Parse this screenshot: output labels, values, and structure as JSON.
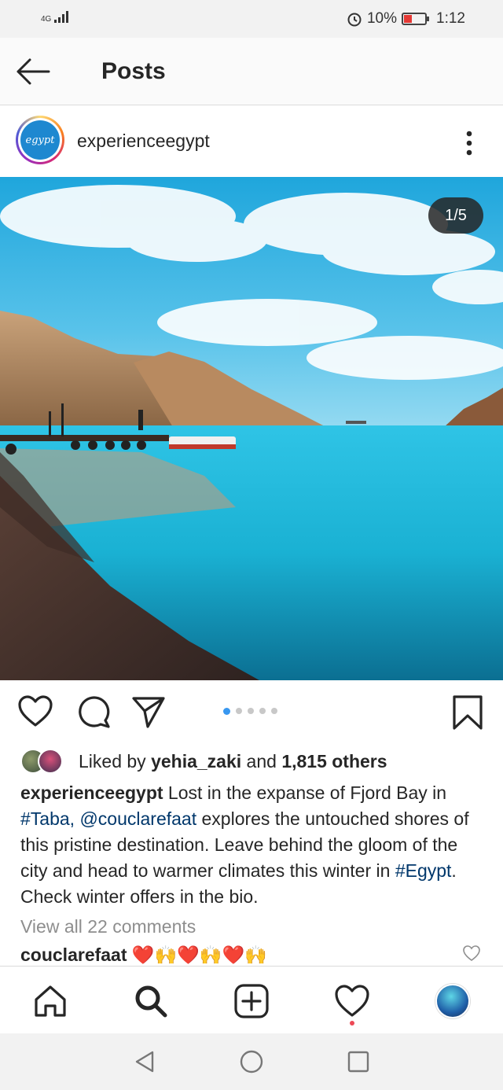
{
  "status_bar": {
    "network": "4G",
    "battery": "10%",
    "time": "1:12"
  },
  "header": {
    "title": "Posts"
  },
  "post": {
    "username": "experienceegypt",
    "avatar_text": "egypt",
    "page_counter": "1/5",
    "carousel": {
      "total": 5,
      "active": 1
    },
    "likes": {
      "prefix": "Liked by ",
      "user": "yehia_zaki",
      "middle": " and ",
      "count": "1,815 others"
    },
    "caption": {
      "username": "experienceegypt",
      "part1": " Lost in the expanse of Fjord Bay in ",
      "tag1": "#Taba,",
      "part2": " ",
      "mention": "@couclarefaat",
      "part3": " explores the untouched shores of this pristine destination. Leave behind the gloom of the city and head to warmer climates this winter in ",
      "tag2": "#Egypt",
      "part4": ". Check winter offers in the bio."
    },
    "view_comments": "View all 22 comments",
    "comment": {
      "username": "couclarefaat",
      "text": " ❤️🙌❤️🙌❤️🙌"
    }
  },
  "colors": {
    "link": "#00376b",
    "dot_active": "#3897f0",
    "notification": "#ed4956"
  },
  "icons": {
    "back": "arrow-left-icon",
    "more": "vertical-dots-icon",
    "like": "heart-icon",
    "comment": "comment-bubble-icon",
    "share": "paper-plane-icon",
    "save": "bookmark-icon",
    "home": "home-icon",
    "search": "search-icon",
    "new_post": "plus-square-icon",
    "activity": "heart-icon",
    "nav_back": "triangle-back-icon",
    "nav_home": "circle-home-icon",
    "nav_recents": "square-recents-icon"
  }
}
